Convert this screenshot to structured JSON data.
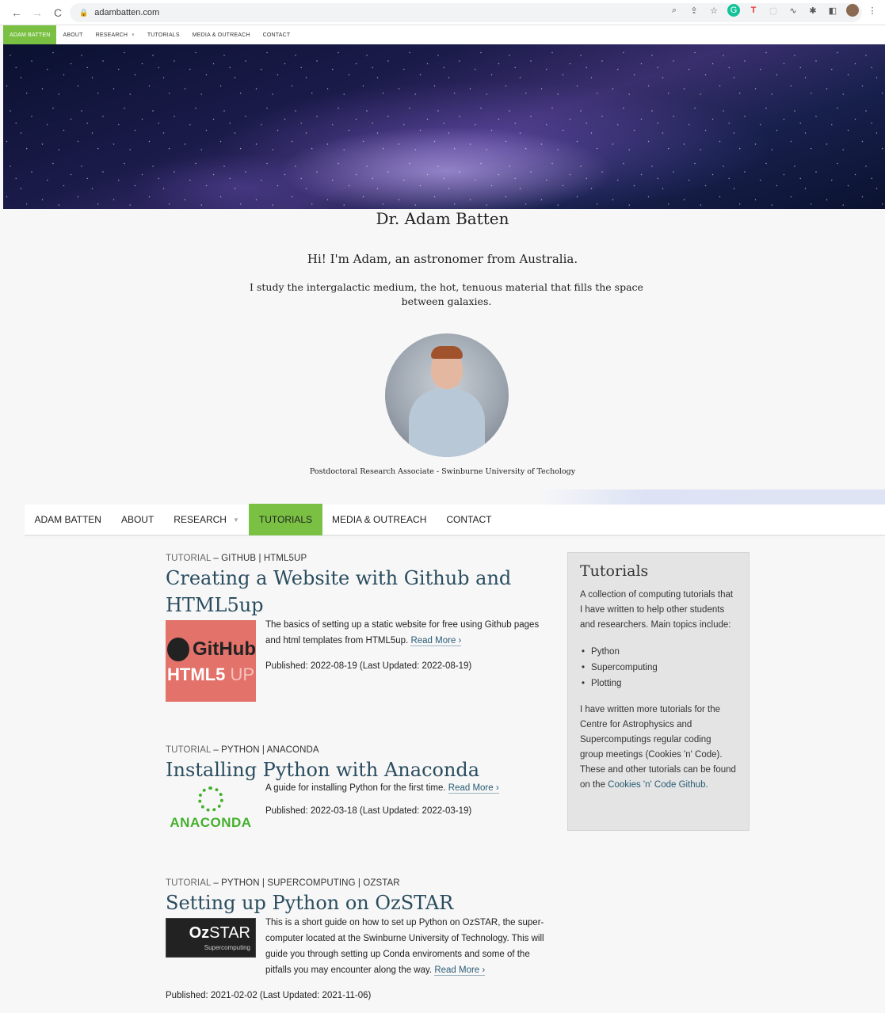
{
  "browser": {
    "url": "adambatten.com",
    "nav": {
      "back": "←",
      "forward": "→",
      "reload": "C"
    }
  },
  "top_nav_small": [
    "ADAM BATTEN",
    "ABOUT",
    "RESEARCH",
    "TUTORIALS",
    "MEDIA & OUTREACH",
    "CONTACT"
  ],
  "profile": {
    "name": "Dr. Adam Batten",
    "greeting": "Hi! I'm Adam, an astronomer from Australia.",
    "intro": "I study the intergalactic medium, the hot, tenuous material that fills the space between galaxies.",
    "role": "Postdoctoral Research Associate - Swinburne University of Techology"
  },
  "main_nav": {
    "items": [
      "ADAM BATTEN",
      "ABOUT",
      "RESEARCH",
      "TUTORIALS",
      "MEDIA & OUTREACH",
      "CONTACT"
    ],
    "active": "TUTORIALS"
  },
  "posts": [
    {
      "cat_prefix": "TUTORIAL",
      "cat_tags": " – GITHUB | HTML5UP",
      "title": "Creating a Website with Github and HTML5up",
      "desc": "The basics of setting up a static website for free using Github pages and html templates from HTML5up.",
      "read_more": "Read More ›",
      "published": "Published: 2022-08-19 (Last Updated: 2022-08-19)",
      "thumb": {
        "line1": "GitHub",
        "line2a": "HTML5",
        "line2b": " UP"
      }
    },
    {
      "cat_prefix": "TUTORIAL",
      "cat_tags": " – PYTHON | ANACONDA",
      "title": "Installing Python with Anaconda",
      "desc": "A guide for installing Python for the first time.",
      "read_more": "Read More ›",
      "published": "Published: 2022-03-18 (Last Updated: 2022-03-19)",
      "thumb": {
        "word": "ANACONDA"
      }
    },
    {
      "cat_prefix": "TUTORIAL",
      "cat_tags": " – PYTHON | SUPERCOMPUTING | OZSTAR",
      "title": "Setting up Python on OzSTAR",
      "desc": "This is a short guide on how to set up Python on OzSTAR, the super-computer located at the Swinburne University of Technology. This will guide you through setting up Conda enviroments and some of the pitfalls you may encounter along the way.",
      "read_more": "Read More ›",
      "published": "Published: 2021-02-02 (Last Updated: 2021-11-06)",
      "thumb": {
        "oz": "Oz",
        "star": "STAR",
        "sub": "Supercomputing"
      }
    }
  ],
  "sidebar": {
    "title": "Tutorials",
    "intro": "A collection of computing tutorials that I have written to help other students and researchers. Main topics include:",
    "topics": [
      "Python",
      "Supercomputing",
      "Plotting"
    ],
    "outro_pre": "I have written more tutorials for the Centre for Astrophysics and Supercomputings regular coding group meetings (Cookies 'n' Code). These and other tutorials can be found on the ",
    "outro_link": "Cookies 'n' Code Github",
    "outro_post": "."
  },
  "colors": {
    "accent": "#7ac143",
    "link": "#2a5c74",
    "title": "#2a4d5e"
  }
}
